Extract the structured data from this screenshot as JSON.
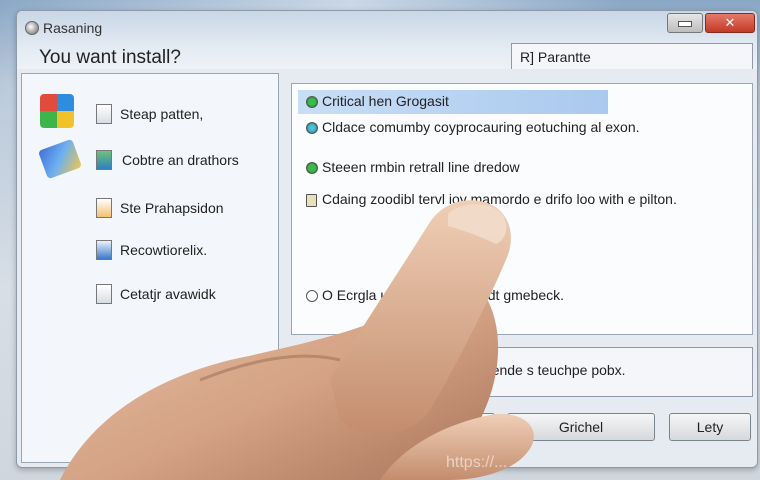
{
  "window": {
    "title": "Rasaning",
    "heading": "You want install?"
  },
  "tab": {
    "label": "R] Parantte"
  },
  "sidebar": {
    "items": [
      {
        "label": "Steap patten,"
      },
      {
        "label": "Cobtre an drathors"
      },
      {
        "label": "Ste Prahapsidon"
      },
      {
        "label": "Recowtiorelix."
      },
      {
        "label": "Cetatjr avawidk"
      }
    ]
  },
  "options": [
    {
      "label": "Critical hen Grogasit"
    },
    {
      "label": "Cldace comumby coyprocauring eotuching al exon."
    },
    {
      "label": "Steeen rmbin retrall line dredow"
    },
    {
      "label": "Cdaing zoodibl tervl ioy mamordo e drifo loo with e pilton."
    },
    {
      "label": "O Ecrgla un       oluring jotonmdt gmebeck."
    }
  ],
  "description": {
    "text": "A oomende s teuchpe pobx."
  },
  "buttons": {
    "continue": "Grichel",
    "exit": "Lety"
  },
  "watermark": "https://..."
}
